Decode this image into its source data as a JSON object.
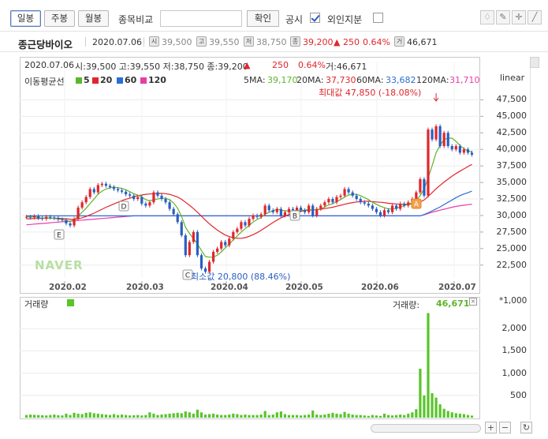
{
  "toolbar": {
    "tabs": [
      "일봉",
      "주봉",
      "월봉"
    ],
    "active_tab": "일봉",
    "compare_label": "종목비교",
    "compare_placeholder": "",
    "confirm_label": "확인",
    "disclosure_label": "공시",
    "foreign_label": "외인지분",
    "disclosure_checked": true,
    "foreign_checked": false
  },
  "info": {
    "name": "종근당바이오",
    "date": "2020.07.06",
    "badges": [
      "시",
      "고",
      "저",
      "종",
      "거"
    ],
    "open": "39,500",
    "high": "39,550",
    "low": "38,750",
    "close": "39,200",
    "change": "▲ 250",
    "change_pct": "0.64%",
    "volume": "46,671"
  },
  "legend": {
    "summary_date": "2020.07.06",
    "summary": "시:39,500 고:39,550 저:38,750 종:39,200",
    "summary_up": "▲",
    "summary_chg": "250",
    "summary_pct": "0.64%",
    "summary_vol": "거:46,671",
    "ma_title": "이동평균선",
    "ma_items": [
      "5",
      "20",
      "60",
      "120"
    ],
    "ma_values": [
      {
        "label": "5MA:",
        "value": "39,170"
      },
      {
        "label": "20MA:",
        "value": "37,730"
      },
      {
        "label": "60MA:",
        "value": "33,682"
      },
      {
        "label": "120MA:",
        "value": "31,710"
      }
    ],
    "scale": "linear",
    "max_label": "최대값 47,850 (-18.08%)",
    "min_label": "최소값 20,800 (88.46%)",
    "watermark": "NAVER",
    "volume_title": "거래량",
    "volume_right_label": "거래량:",
    "volume_right_value": "46,671",
    "volume_unit": "*1,000"
  },
  "colors": {
    "up": "#e0262d",
    "down": "#2a5fc1",
    "ma5": "#5eb52a",
    "ma20": "#e0262d",
    "ma60": "#2a6fd6",
    "ma120": "#ea3ca8",
    "volume": "#5ac42a"
  },
  "markers": [
    "E",
    "D",
    "C",
    "B",
    "A"
  ],
  "chart_data": {
    "type": "candlestick",
    "title": "",
    "price_axis": [
      "47,500",
      "45,000",
      "42,500",
      "40,000",
      "37,500",
      "35,000",
      "32,500",
      "30,000",
      "27,500",
      "25,000",
      "22,500"
    ],
    "date_axis": [
      "2020.02",
      "2020.03",
      "2020.04",
      "2020.05",
      "2020.06",
      "2020.07"
    ],
    "volume_axis": [
      "2,000",
      "1,500",
      "1,000",
      "500"
    ],
    "ylim": [
      20800,
      48500
    ],
    "closes": [
      29800,
      29700,
      29900,
      29600,
      29500,
      29800,
      29700,
      29600,
      29400,
      29300,
      28800,
      28500,
      29500,
      31200,
      32000,
      32800,
      34000,
      33500,
      34600,
      34800,
      34500,
      34300,
      34000,
      33800,
      33600,
      33200,
      33000,
      32500,
      32800,
      31800,
      31500,
      32000,
      33500,
      33000,
      32500,
      32000,
      31000,
      30200,
      29000,
      27000,
      24000,
      26000,
      27500,
      24000,
      22000,
      21500,
      23000,
      24500,
      25000,
      26000,
      25500,
      26500,
      27500,
      28000,
      29000,
      28500,
      29500,
      30000,
      29800,
      30200,
      31500,
      30800,
      30500,
      31000,
      30000,
      30500,
      31000,
      30800,
      31200,
      30800,
      30500,
      31500,
      30000,
      31000,
      31500,
      32000,
      32500,
      32000,
      32800,
      33000,
      34000,
      33500,
      33000,
      32500,
      32000,
      31800,
      31500,
      31000,
      30500,
      30000,
      30800,
      30500,
      31500,
      31000,
      31800,
      31500,
      32000,
      32500,
      33500,
      35500,
      33000,
      43000,
      41500,
      43500,
      40500,
      42500,
      40500,
      40000,
      40500,
      39500,
      40000,
      39500,
      39200
    ],
    "volumes_k": [
      60,
      70,
      65,
      60,
      55,
      50,
      60,
      70,
      55,
      50,
      90,
      60,
      110,
      90,
      80,
      110,
      120,
      100,
      90,
      80,
      70,
      60,
      80,
      60,
      70,
      60,
      50,
      55,
      60,
      50,
      60,
      120,
      90,
      60,
      70,
      80,
      90,
      100,
      110,
      100,
      140,
      120,
      90,
      180,
      120,
      70,
      80,
      90,
      70,
      60,
      60,
      70,
      90,
      80,
      60,
      70,
      60,
      60,
      60,
      70,
      150,
      60,
      70,
      120,
      140,
      80,
      60,
      60,
      60,
      50,
      60,
      70,
      160,
      70,
      60,
      70,
      90,
      110,
      90,
      80,
      130,
      90,
      70,
      60,
      60,
      50,
      40,
      60,
      50,
      40,
      90,
      60,
      50,
      60,
      70,
      60,
      90,
      120,
      190,
      1100,
      500,
      2350,
      550,
      450,
      300,
      200,
      150,
      120,
      100,
      90,
      80,
      60,
      47
    ],
    "ma5": [
      29850,
      29750,
      29800,
      29700,
      29600,
      29650,
      29600,
      29550,
      29500,
      29400,
      29250,
      29100,
      29350,
      29950,
      30500,
      31100,
      31800,
      32500,
      33200,
      33700,
      34000,
      34200,
      34300,
      34200,
      34100,
      33900,
      33600,
      33300,
      33100,
      32800,
      32400,
      32200,
      32400,
      32500,
      32600,
      32600,
      32400,
      31900,
      31100,
      29900,
      28200,
      27300,
      26500,
      25700,
      24700,
      23800,
      23700,
      23700,
      24000,
      24500,
      25100,
      25700,
      26300,
      26900,
      27500,
      28000,
      28500,
      29000,
      29400,
      29700,
      30200,
      30500,
      30700,
      31000,
      30800,
      30700,
      30700,
      30700,
      30800,
      30800,
      30800,
      30900,
      30800,
      30900,
      31000,
      31300,
      31600,
      31800,
      32100,
      32400,
      32800,
      33100,
      33200,
      33200,
      33000,
      32700,
      32400,
      32000,
      31700,
      31400,
      31200,
      31000,
      31000,
      31100,
      31300,
      31500,
      31700,
      31900,
      32300,
      33000,
      34000,
      35700,
      37500,
      39500,
      40600,
      41500,
      41700,
      41700,
      41200,
      40600,
      40100,
      39800,
      39600
    ],
    "ma20": [
      29500,
      29500,
      29550,
      29550,
      29550,
      29600,
      29600,
      29600,
      29600,
      29550,
      29500,
      29450,
      29400,
      29500,
      29650,
      29850,
      30100,
      30350,
      30650,
      30950,
      31250,
      31500,
      31750,
      32000,
      32250,
      32450,
      32650,
      32850,
      33000,
      33100,
      33200,
      33250,
      33300,
      33350,
      33350,
      33300,
      33200,
      33000,
      32800,
      32450,
      32000,
      31550,
      31050,
      30500,
      29900,
      29300,
      28750,
      28250,
      27800,
      27400,
      27050,
      26800,
      26650,
      26550,
      26550,
      26650,
      26850,
      27100,
      27400,
      27750,
      28150,
      28550,
      28950,
      29300,
      29650,
      29900,
      30150,
      30350,
      30500,
      30650,
      30750,
      30800,
      30850,
      30900,
      30950,
      31050,
      31150,
      31250,
      31400,
      31550,
      31700,
      31850,
      31950,
      32050,
      32100,
      32150,
      32150,
      32100,
      32050,
      32000,
      31950,
      31850,
      31800,
      31750,
      31700,
      31700,
      31700,
      31750,
      31850,
      32050,
      32350,
      32900,
      33450,
      34050,
      34550,
      35050,
      35500,
      35950,
      36350,
      36700,
      37050,
      37400,
      37730
    ],
    "ma60": [
      29950,
      29950,
      29950,
      29950,
      29950,
      29950,
      29950,
      29950,
      29950,
      29950,
      29950,
      29950,
      29950,
      29950,
      29950,
      29950,
      29950,
      29950,
      29950,
      29950,
      29950,
      29950,
      29950,
      29950,
      29950,
      29950,
      29950,
      29950,
      29950,
      29950,
      29950,
      29950,
      29950,
      29950,
      29950,
      29950,
      29950,
      29950,
      29950,
      29950,
      29950,
      29950,
      29950,
      29950,
      29950,
      29950,
      29950,
      29950,
      29950,
      29950,
      29950,
      29950,
      29950,
      29950,
      29950,
      29950,
      29950,
      29950,
      29950,
      29950,
      29950,
      29950,
      29950,
      29950,
      29950,
      29950,
      29950,
      29950,
      29950,
      29950,
      29950,
      29950,
      29950,
      29950,
      29950,
      29950,
      29950,
      29950,
      29950,
      29950,
      29950,
      29950,
      29950,
      29950,
      29950,
      29950,
      29950,
      29950,
      29950,
      29950,
      29950,
      29950,
      29950,
      29950,
      29950,
      29950,
      29950,
      29950,
      29950,
      29950,
      30150,
      30400,
      30700,
      31000,
      31300,
      31650,
      32000,
      32350,
      32700,
      33000,
      33250,
      33450,
      33682
    ],
    "ma120": [
      28600,
      28650,
      28700,
      28750,
      28800,
      28850,
      28900,
      28950,
      29000,
      29050,
      29100,
      29150,
      29200,
      29250,
      29300,
      29350,
      29400,
      29450,
      29500,
      29550,
      29600,
      29650,
      29700,
      29750,
      29800,
      29850,
      29900,
      29950,
      29950,
      29950,
      29950,
      29950,
      29950,
      29950,
      29950,
      29950,
      29950,
      29950,
      29950,
      29950,
      29950,
      29950,
      29950,
      29950,
      29950,
      29950,
      29950,
      29950,
      29950,
      29950,
      29950,
      29950,
      29950,
      29950,
      29950,
      29950,
      29950,
      29950,
      29950,
      29950,
      29950,
      29950,
      29950,
      29950,
      29950,
      29950,
      29950,
      29950,
      29950,
      29950,
      29950,
      29950,
      29950,
      29950,
      29950,
      29950,
      29950,
      29950,
      29950,
      29950,
      29950,
      29950,
      29950,
      29950,
      29950,
      29950,
      29950,
      29950,
      29950,
      29950,
      29950,
      29950,
      29950,
      29950,
      29950,
      29950,
      29950,
      29950,
      29950,
      29950,
      30100,
      30300,
      30500,
      30650,
      30800,
      30950,
      31100,
      31250,
      31380,
      31480,
      31560,
      31640,
      31710
    ]
  }
}
